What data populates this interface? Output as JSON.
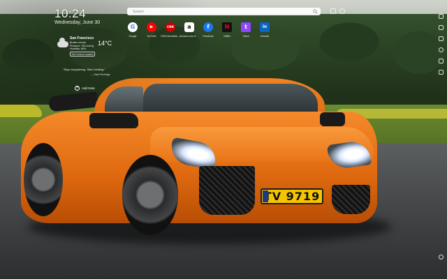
{
  "clock": {
    "time": "10:24",
    "date": "Wednesday, June 30"
  },
  "weather": {
    "city": "San Francisco",
    "condition": "Broken clouds",
    "pressure": "Pressure: 765 mmHg",
    "humidity": "Humidity: 86%",
    "temperature": "14°C",
    "button_label": "Set Current Location",
    "icon": "cloud-icon"
  },
  "quote": {
    "text": "\"Stop complaining. Start creating.\"",
    "author": "— Dale Partridge"
  },
  "add_note": {
    "label": "Add Note",
    "icon": "plus-circle-icon"
  },
  "search": {
    "placeholder": "Search",
    "icon": "search-icon"
  },
  "shortcuts": [
    {
      "label": "Google",
      "letter": "G",
      "color": "#ffffff",
      "text_color": "#4285f4"
    },
    {
      "label": "YouTube",
      "letter": "▶",
      "color": "#ff0000",
      "text_color": "#ffffff"
    },
    {
      "label": "CNN International - ...",
      "letter": "CNN",
      "color": "#cc0000",
      "text_color": "#ffffff"
    },
    {
      "label": "Amazon.com Online ...",
      "letter": "a",
      "color": "#ffffff",
      "text_color": "#111111"
    },
    {
      "label": "Facebook",
      "letter": "f",
      "color": "#1877f2",
      "text_color": "#ffffff"
    },
    {
      "label": "Netflix",
      "letter": "N",
      "color": "#111111",
      "text_color": "#e50914"
    },
    {
      "label": "Twitch",
      "letter": "t",
      "color": "#9146ff",
      "text_color": "#ffffff"
    },
    {
      "label": "Linkedin",
      "letter": "in",
      "color": "#0a66c2",
      "text_color": "#ffffff"
    }
  ],
  "plate": {
    "text": "TV 9719"
  },
  "colors": {
    "car": "#e8701a",
    "plate": "#f4c500",
    "sky": "#cfd3cc"
  }
}
